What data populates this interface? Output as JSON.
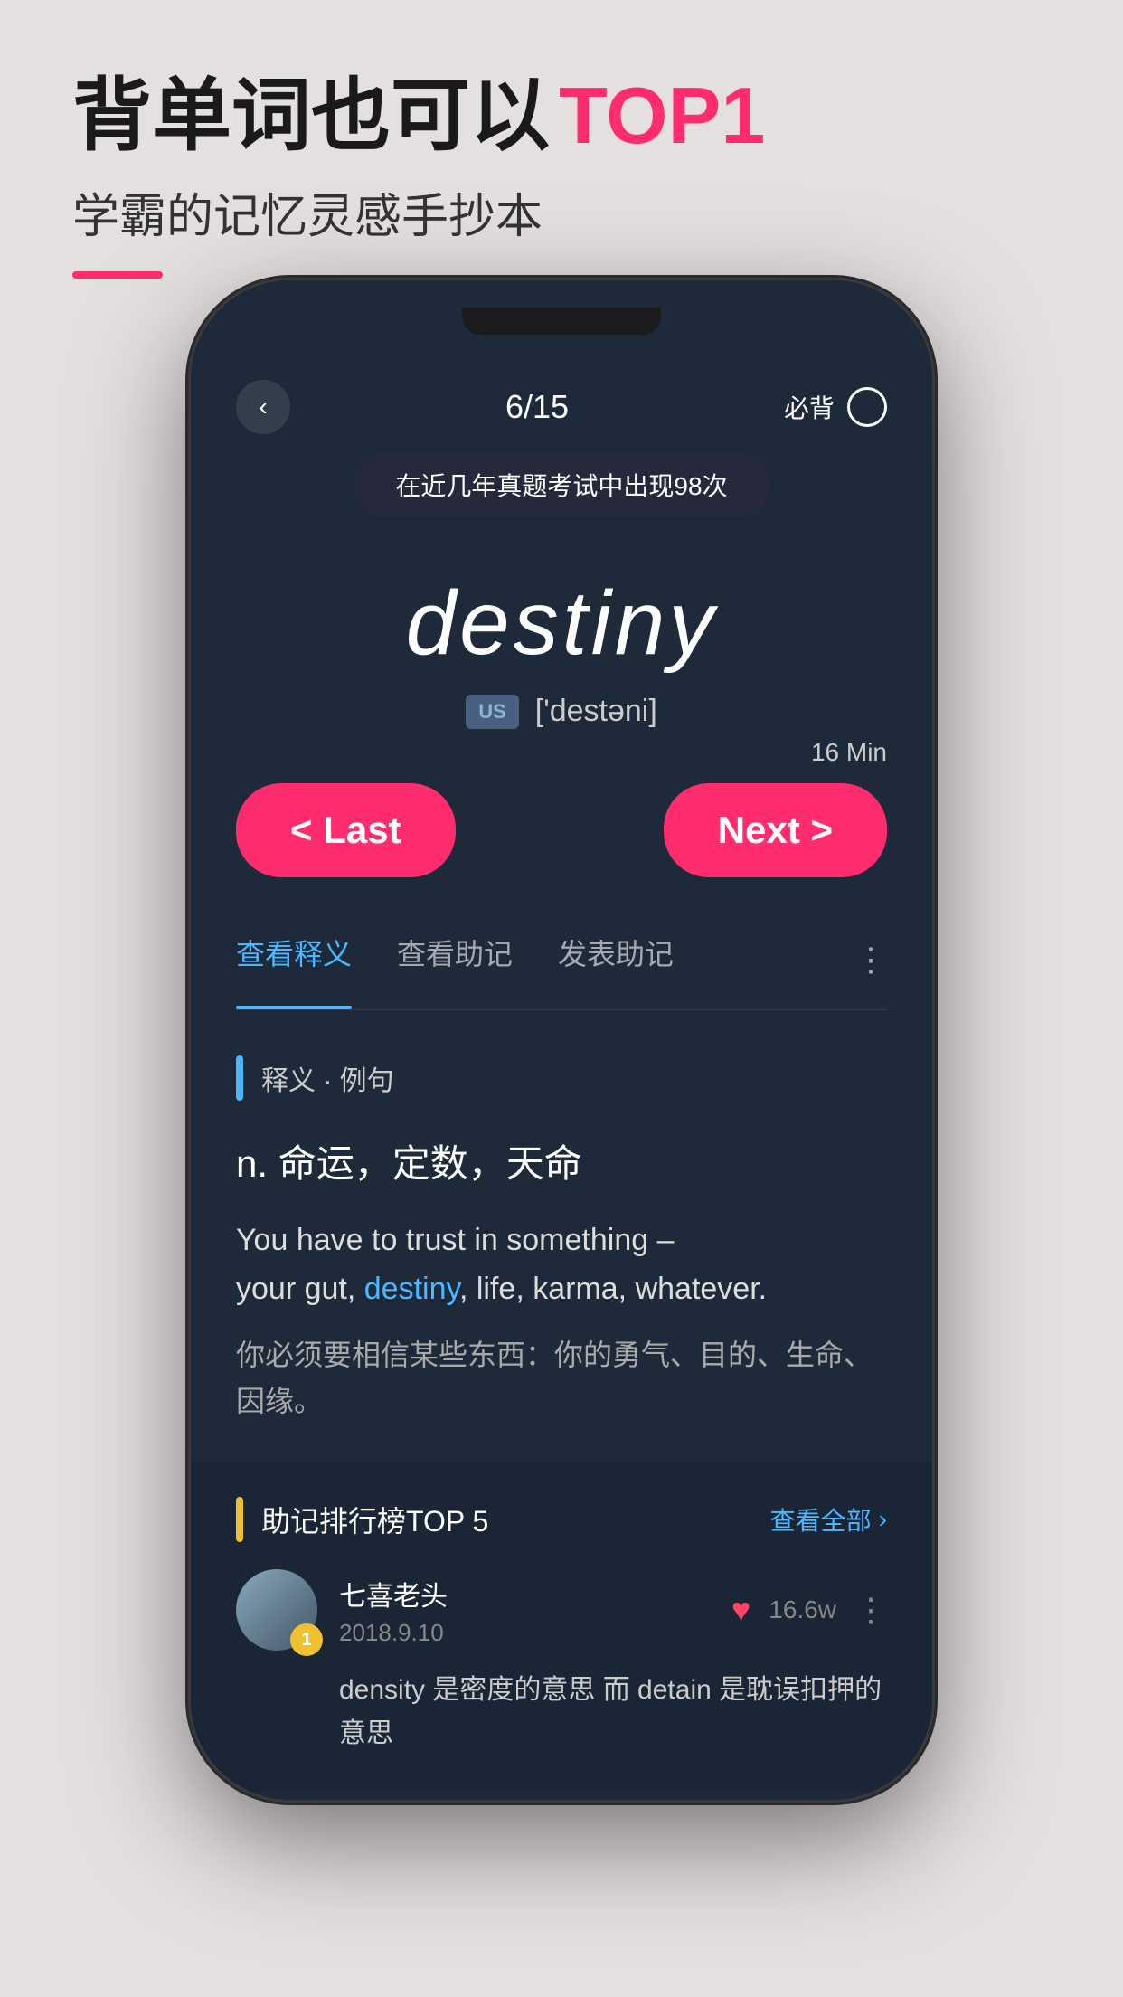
{
  "page": {
    "bg_color": "#e0dbdb"
  },
  "header": {
    "main_title_part1": "背单词也可以",
    "main_title_highlight": "TOP1",
    "sub_title": "学霸的记忆灵感手抄本",
    "underline_color": "#ff2d6e"
  },
  "phone": {
    "screen": {
      "progress": "6/15",
      "must_memorize_label": "必背",
      "tooltip": "在近几年真题考试中出现98次",
      "word": "destiny",
      "phonetic_region": "US",
      "phonetic": "['destəni]",
      "timer": "16 Min",
      "nav_last": "< Last",
      "nav_next": "Next >",
      "tabs": [
        "查看释义",
        "查看助记",
        "发表助记"
      ],
      "active_tab": "查看释义",
      "section_label": "释义 · 例句",
      "definition": "n. 命运，定数，天命",
      "example_en_before": "You have to trust in something –",
      "example_en_mid_before": "your gut, ",
      "example_en_highlight": "destiny",
      "example_en_mid_after": ", life, karma, whatever.",
      "example_cn": "你必须要相信某些东西：你的勇气、目的、生命、因缘。",
      "ranking_title": "助记排行榜TOP 5",
      "view_all": "查看全部",
      "user_name": "七喜老头",
      "user_date": "2018.9.10",
      "like_count": "16.6w",
      "mnemonic_preview": "density 是密度的意思 而 detain 是耽误扣押的意思",
      "rank_num": "1"
    }
  }
}
